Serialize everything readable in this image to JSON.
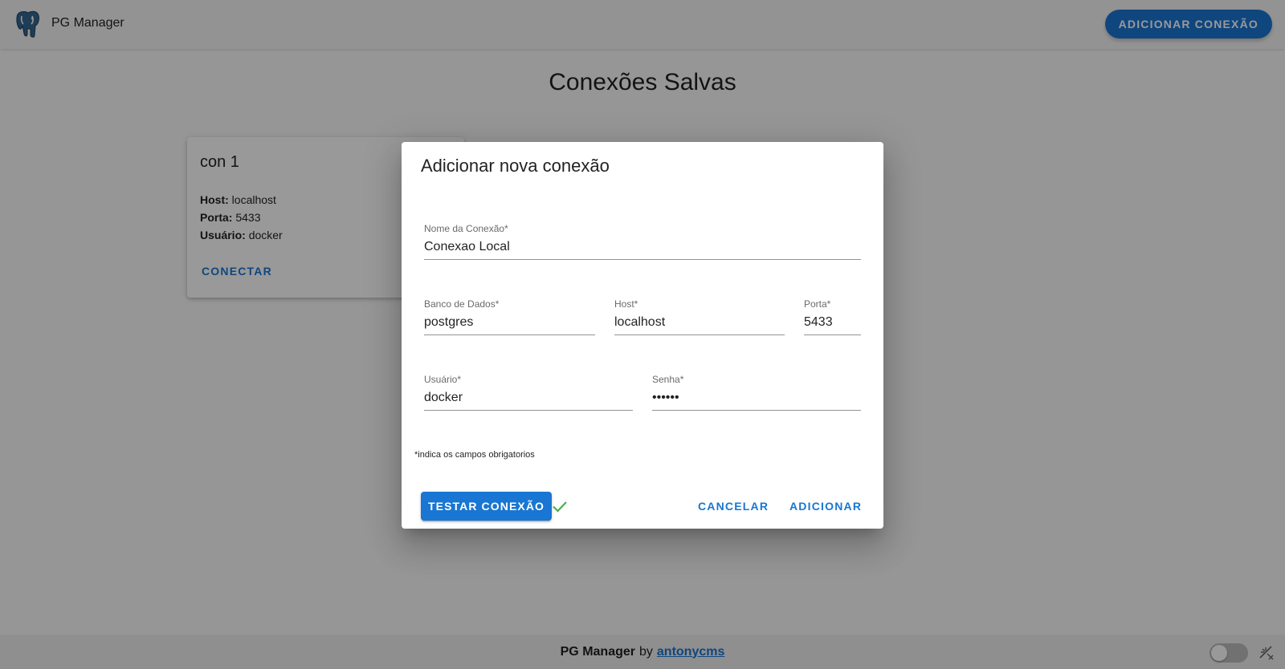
{
  "app": {
    "title": "PG Manager",
    "add_connection_label": "ADICIONAR CONEXÃO",
    "logo_icon": "postgres-elephant-icon"
  },
  "page": {
    "heading": "Conexões Salvas"
  },
  "saved_connections": [
    {
      "name": "con 1",
      "host_label": "Host:",
      "host": "localhost",
      "port_label": "Porta:",
      "port": "5433",
      "user_label": "Usuário:",
      "user": "docker",
      "connect_label": "CONECTAR"
    }
  ],
  "dialog": {
    "title": "Adicionar nova conexão",
    "fields": {
      "connection_name": {
        "label": "Nome da Conexão*",
        "value": "Conexao Local"
      },
      "database": {
        "label": "Banco de Dados*",
        "value": "postgres"
      },
      "host": {
        "label": "Host*",
        "value": "localhost"
      },
      "port": {
        "label": "Porta*",
        "value": "5433"
      },
      "user": {
        "label": "Usuário*",
        "value": "docker"
      },
      "password": {
        "label": "Senha*",
        "value": "••••••"
      }
    },
    "required_note": "*indica os campos obrigatorios",
    "test_button": "TESTAR CONEXÃO",
    "test_status_icon": "check-icon",
    "cancel_button": "CANCELAR",
    "add_button": "ADICIONAR"
  },
  "footer": {
    "app_name": "PG Manager",
    "by": "by",
    "author": "antonycms",
    "theme_icon": "theme-toggle-icon"
  },
  "colors": {
    "primary": "#1976d2",
    "success": "#4caf50",
    "backdrop": "rgba(0,0,0,0.4)"
  }
}
